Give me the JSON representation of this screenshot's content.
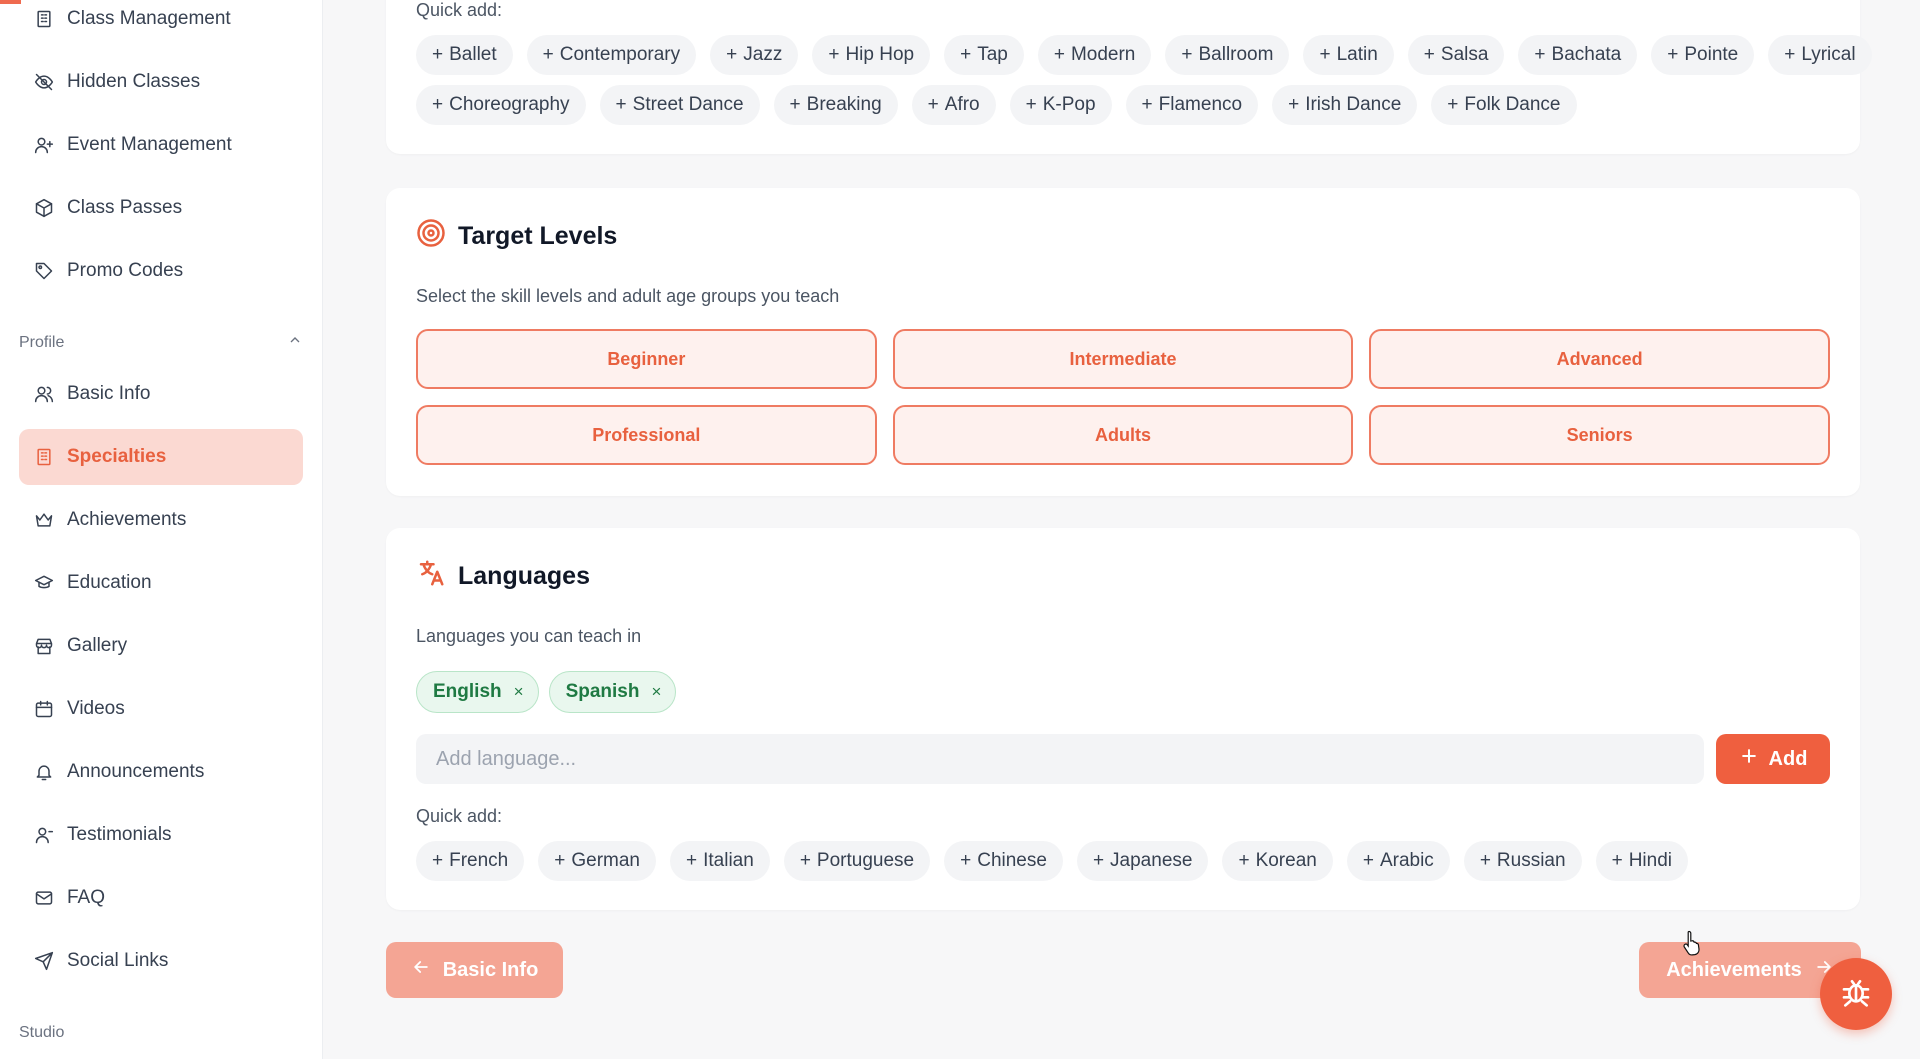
{
  "sidebar": {
    "items_top": [
      {
        "label": "Class Management",
        "icon": "building-icon"
      },
      {
        "label": "Hidden Classes",
        "icon": "eye-off-icon"
      },
      {
        "label": "Event Management",
        "icon": "user-plus-icon"
      },
      {
        "label": "Class Passes",
        "icon": "box-icon"
      },
      {
        "label": "Promo Codes",
        "icon": "tag-icon"
      }
    ],
    "profile_section": "Profile",
    "profile_items": [
      {
        "label": "Basic Info",
        "icon": "users-icon"
      },
      {
        "label": "Specialties",
        "icon": "building-icon"
      },
      {
        "label": "Achievements",
        "icon": "crown-icon"
      },
      {
        "label": "Education",
        "icon": "graduation-cap-icon"
      },
      {
        "label": "Gallery",
        "icon": "store-icon"
      },
      {
        "label": "Videos",
        "icon": "calendar-icon"
      },
      {
        "label": "Announcements",
        "icon": "bell-icon"
      },
      {
        "label": "Testimonials",
        "icon": "user-icon"
      },
      {
        "label": "FAQ",
        "icon": "mail-icon"
      },
      {
        "label": "Social Links",
        "icon": "send-icon"
      }
    ],
    "studio_section": "Studio"
  },
  "styles": {
    "quick_label": "Quick add:",
    "chips_row1": [
      "Ballet",
      "Contemporary",
      "Jazz",
      "Hip Hop",
      "Tap",
      "Modern",
      "Ballroom",
      "Latin",
      "Salsa",
      "Bachata",
      "Pointe",
      "Lyrical"
    ],
    "chips_row2": [
      "Choreography",
      "Street Dance",
      "Breaking",
      "Afro",
      "K-Pop",
      "Flamenco",
      "Irish Dance",
      "Folk Dance"
    ]
  },
  "target_levels": {
    "title": "Target Levels",
    "subtitle": "Select the skill levels and adult age groups you teach",
    "levels": [
      "Beginner",
      "Intermediate",
      "Advanced",
      "Professional",
      "Adults",
      "Seniors"
    ]
  },
  "languages": {
    "title": "Languages",
    "subtitle": "Languages you can teach in",
    "selected": [
      "English",
      "Spanish"
    ],
    "remove_symbol": "×",
    "input_placeholder": "Add language...",
    "add_label": "Add",
    "quick_label": "Quick add:",
    "quick": [
      "French",
      "German",
      "Italian",
      "Portuguese",
      "Chinese",
      "Japanese",
      "Korean",
      "Arabic",
      "Russian",
      "Hindi"
    ]
  },
  "footer": {
    "prev_label": "Basic Info",
    "next_label": "Achievements"
  },
  "colors": {
    "accent": "#ef5f3f",
    "accent_soft": "#fbd9d2",
    "tag_green": "#1f7a43"
  }
}
